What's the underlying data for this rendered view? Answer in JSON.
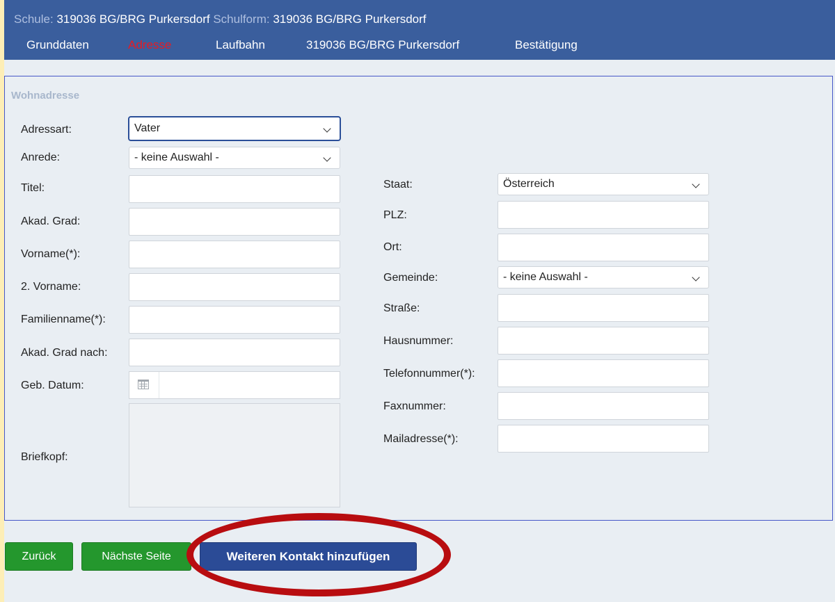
{
  "header": {
    "schule_label": "Schule:",
    "schule_value": "319036 BG/BRG Purkersdorf",
    "schulform_label": "Schulform:",
    "schulform_value": "319036 BG/BRG Purkersdorf"
  },
  "nav": [
    {
      "label": "Grunddaten",
      "active": false
    },
    {
      "label": "Adresse",
      "active": true
    },
    {
      "label": "Laufbahn",
      "active": false
    },
    {
      "label": "319036 BG/BRG Purkersdorf",
      "active": false
    },
    {
      "label": "Bestätigung",
      "active": false
    }
  ],
  "section_title": "Wohnadresse",
  "left_fields": {
    "adressart": {
      "label": "Adressart:",
      "value": "Vater"
    },
    "anrede": {
      "label": "Anrede:",
      "value": "- keine Auswahl -"
    },
    "titel": {
      "label": "Titel:",
      "value": ""
    },
    "akad_grad": {
      "label": "Akad. Grad:",
      "value": ""
    },
    "vorname": {
      "label": "Vorname(*):",
      "value": ""
    },
    "vorname2": {
      "label": "2. Vorname:",
      "value": ""
    },
    "familienname": {
      "label": "Familienname(*):",
      "value": ""
    },
    "akad_grad_nach": {
      "label": "Akad. Grad nach:",
      "value": ""
    },
    "geb_datum": {
      "label": "Geb. Datum:",
      "value": ""
    },
    "briefkopf": {
      "label": "Briefkopf:",
      "value": ""
    }
  },
  "right_fields": {
    "staat": {
      "label": "Staat:",
      "value": "Österreich"
    },
    "plz": {
      "label": "PLZ:",
      "value": ""
    },
    "ort": {
      "label": "Ort:",
      "value": ""
    },
    "gemeinde": {
      "label": "Gemeinde:",
      "value": "- keine Auswahl -"
    },
    "strasse": {
      "label": "Straße:",
      "value": ""
    },
    "hausnummer": {
      "label": "Hausnummer:",
      "value": ""
    },
    "telefonnummer": {
      "label": "Telefonnummer(*):",
      "value": ""
    },
    "faxnummer": {
      "label": "Faxnummer:",
      "value": ""
    },
    "mailadresse": {
      "label": "Mailadresse(*):",
      "value": ""
    }
  },
  "buttons": {
    "back": "Zurück",
    "next": "Nächste Seite",
    "add_contact": "Weiteren Kontakt hinzufügen"
  },
  "colors": {
    "topbar": "#3a5e9d",
    "active_nav": "#e51b24",
    "green_button": "#24972d",
    "blue_button": "#2b4b96",
    "annotation_ring": "#b80d10",
    "page_border": "#fdeeb6"
  }
}
